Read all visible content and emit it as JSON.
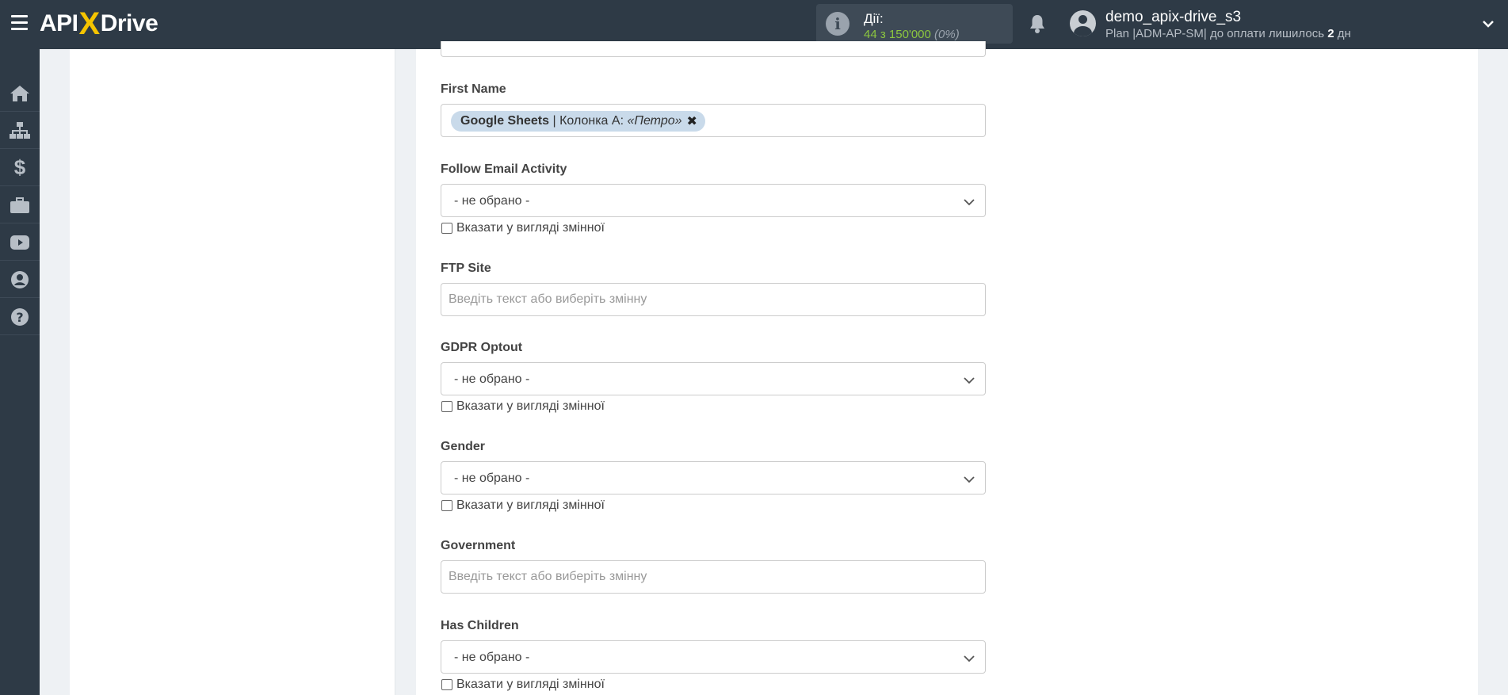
{
  "header": {
    "logo_text_left": "API",
    "logo_text_x": "X",
    "logo_text_right": "Drive",
    "actions": {
      "label": "Дії:",
      "used": "44",
      "of_text": "з",
      "total": "150'000",
      "percent": "(0%)"
    },
    "user": {
      "name": "demo_apix-drive_s3",
      "plan_prefix": "Plan |ADM-AP-SM| до оплати лишилось",
      "days": "2",
      "days_unit": "дн"
    }
  },
  "sidebar": {
    "items": [
      {
        "icon": "home-icon"
      },
      {
        "icon": "sitemap-icon"
      },
      {
        "icon": "dollar-icon"
      },
      {
        "icon": "briefcase-icon"
      },
      {
        "icon": "youtube-icon"
      },
      {
        "icon": "user-circle-icon"
      },
      {
        "icon": "question-circle-icon"
      }
    ]
  },
  "form": {
    "first_name": {
      "label": "First Name",
      "tag_source": "Google Sheets",
      "tag_sep": " | Колонка А: ",
      "tag_value": "«Петро»"
    },
    "follow_email_activity": {
      "label": "Follow Email Activity",
      "value": "- не обрано -",
      "checkbox_label": "Вказати у вигляді змінної"
    },
    "ftp_site": {
      "label": "FTP Site",
      "placeholder": "Введіть текст або виберіть змінну"
    },
    "gdpr_optout": {
      "label": "GDPR Optout",
      "value": "- не обрано -",
      "checkbox_label": "Вказати у вигляді змінної"
    },
    "gender": {
      "label": "Gender",
      "value": "- не обрано -",
      "checkbox_label": "Вказати у вигляді змінної"
    },
    "government": {
      "label": "Government",
      "placeholder": "Введіть текст або виберіть змінну"
    },
    "has_children": {
      "label": "Has Children",
      "value": "- не обрано -",
      "checkbox_label": "Вказати у вигляді змінної"
    }
  }
}
